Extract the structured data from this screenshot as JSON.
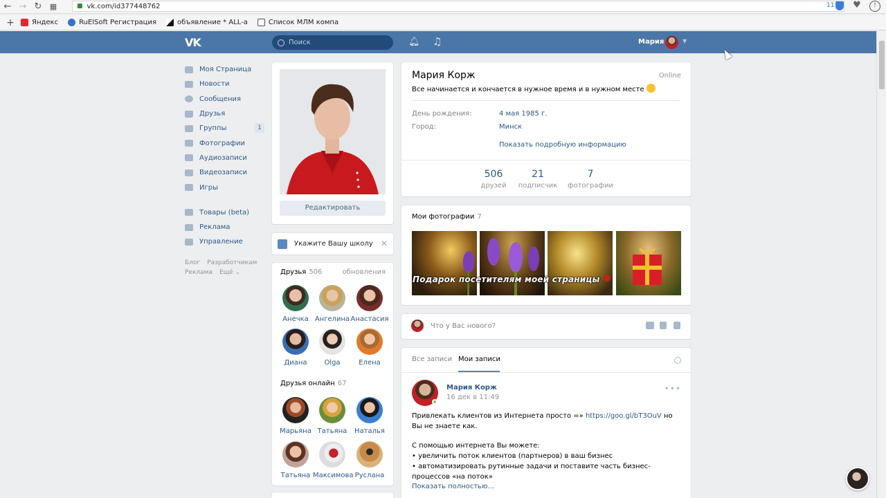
{
  "browser": {
    "url": "vk.com/id377448762",
    "ext_count": "11",
    "bookmarks": [
      "Яндекс",
      "RuElSoft Регистрация",
      "объявление * ALL-a",
      "Список МЛМ компа"
    ]
  },
  "header": {
    "search_placeholder": "Поиск",
    "user_name": "Мария"
  },
  "menu": {
    "items": [
      {
        "label": "Моя Страница"
      },
      {
        "label": "Новости"
      },
      {
        "label": "Сообщения"
      },
      {
        "label": "Друзья"
      },
      {
        "label": "Группы",
        "badge": "1"
      },
      {
        "label": "Фотографии"
      },
      {
        "label": "Аудиозаписи"
      },
      {
        "label": "Видеозаписи"
      },
      {
        "label": "Игры"
      }
    ],
    "extra": [
      {
        "label": "Товары (beta)"
      },
      {
        "label": "Реклама"
      },
      {
        "label": "Управление"
      }
    ],
    "footer": [
      "Блог",
      "Разработчикам",
      "Реклама",
      "Ещё ⌄"
    ]
  },
  "profile": {
    "edit_label": "Редактировать",
    "school_prompt": "Укажите Вашу школу",
    "name": "Мария Корж",
    "online": "Online",
    "status": "Все начинается и кончается в нужное время и в нужном месте",
    "birthday_label": "День рождения:",
    "birthday_value": "4 мая 1985 г.",
    "city_label": "Город:",
    "city_value": "Минск",
    "details_link": "Показать подробную информацию",
    "counters": [
      {
        "n": "506",
        "l": "друзей"
      },
      {
        "n": "21",
        "l": "подписчик"
      },
      {
        "n": "7",
        "l": "фотографии"
      }
    ]
  },
  "friends": {
    "title": "Друзья",
    "count": "506",
    "updates": "обновления",
    "list": [
      "Анечка",
      "Ангелина",
      "Анастасия",
      "Диана",
      "Olga",
      "Елена"
    ],
    "online_title": "Друзья онлайн",
    "online_count": "67",
    "online_list": [
      "Марьяна",
      "Татьяна",
      "Наталья",
      "Татьяна",
      "Максимова",
      "Руслана"
    ]
  },
  "photos": {
    "title": "Мои фотографии",
    "count": "7",
    "banner": "Подарок посетителям моей страницы"
  },
  "new_post": {
    "placeholder": "Что у Вас нового?"
  },
  "wall": {
    "tab_all": "Все записи",
    "tab_mine": "Мои записи",
    "post": {
      "author": "Мария Корж",
      "date": "16 дек в 11:49",
      "line1_pre": "Привлекать клиентов из Интернета просто =» ",
      "line1_link": "https://goo.gl/bT3OuV",
      "line1_post": " но Вы не знаете как.",
      "line2": "С помощью интернета Вы можете:",
      "line3": "• увеличить поток клиентов (партнеров) в ваш бизнес",
      "line4": "• автоматизировать рутинные задачи и поставите часть бизнес-процессов «на поток»",
      "show_more": "Показать полностью..."
    }
  },
  "colors": {
    "header": "#4a76a8",
    "link": "#2a5885",
    "background": "#edeef0"
  }
}
